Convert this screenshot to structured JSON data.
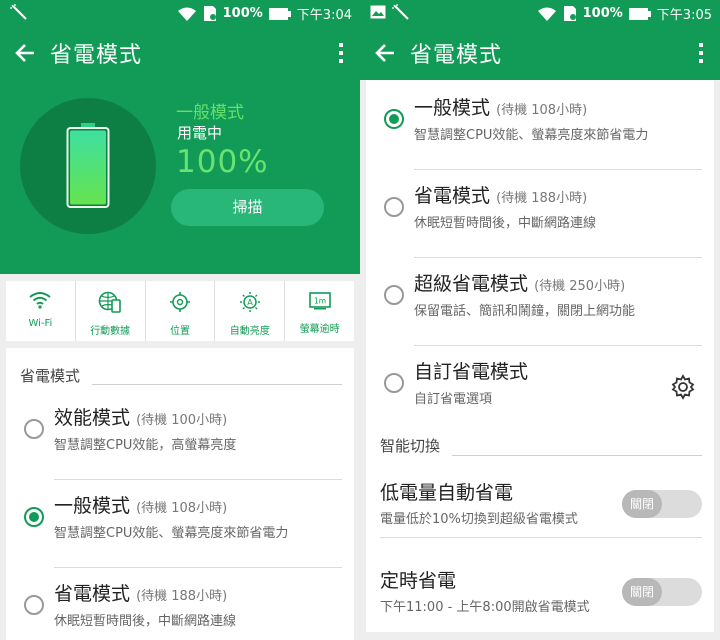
{
  "left": {
    "status": {
      "battery": "100%",
      "time": "下午3:04"
    },
    "app_bar": {
      "title": "省電模式"
    },
    "hero": {
      "mode_name": "一般模式",
      "status": "用電中",
      "percent": "100%",
      "battery_level": 1.0,
      "scan_label": "掃描"
    },
    "quick_settings": [
      {
        "label": "Wi-Fi",
        "icon": "wifi-icon"
      },
      {
        "label": "行動數據",
        "icon": "mobile-data-icon"
      },
      {
        "label": "位置",
        "icon": "location-icon"
      },
      {
        "label": "自動亮度",
        "icon": "auto-brightness-icon"
      },
      {
        "label": "螢幕逾時",
        "icon": "screen-timeout-icon"
      }
    ],
    "quick_timeout_badge": "1m",
    "section": "省電模式",
    "modes": [
      {
        "title": "效能模式",
        "hint": "(待機 100小時)",
        "desc": "智慧調整CPU效能，高螢幕亮度",
        "selected": false
      },
      {
        "title": "一般模式",
        "hint": "(待機 108小時)",
        "desc": "智慧調整CPU效能、螢幕亮度來節省電力",
        "selected": true
      },
      {
        "title": "省電模式",
        "hint": "(待機 188小時)",
        "desc": "休眠短暫時間後，中斷網路連線",
        "selected": false
      }
    ]
  },
  "right": {
    "status": {
      "battery": "100%",
      "time": "下午3:05"
    },
    "app_bar": {
      "title": "省電模式"
    },
    "modes": [
      {
        "title": "一般模式",
        "hint": "(待機 108小時)",
        "desc": "智慧調整CPU效能、螢幕亮度來節省電力",
        "selected": true
      },
      {
        "title": "省電模式",
        "hint": "(待機 188小時)",
        "desc": "休眠短暫時間後，中斷網路連線",
        "selected": false
      },
      {
        "title": "超級省電模式",
        "hint": "(待機 250小時)",
        "desc": "保留電話、簡訊和鬧鐘，關閉上網功能",
        "selected": false
      },
      {
        "title": "自訂省電模式",
        "hint": "",
        "desc": "自訂省電選項",
        "selected": false
      }
    ],
    "smart_section": "智能切換",
    "smart": [
      {
        "title": "低電量自動省電",
        "desc": "電量低於10%切換到超級省電模式",
        "toggle": "關閉"
      },
      {
        "title": "定時省電",
        "desc": "下午11:00 - 上午8:00開啟省電模式",
        "toggle": "關閉"
      }
    ]
  },
  "colors": {
    "primary": "#129b56",
    "accent": "#65e06c",
    "scan_button": "#28b779"
  }
}
